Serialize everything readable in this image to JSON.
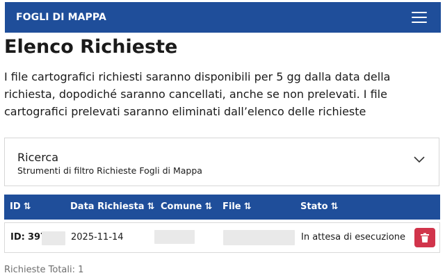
{
  "header": {
    "brand": "FOGLI DI MAPPA",
    "menu_icon": "hamburger-icon",
    "bg_color": "#1f4e9a"
  },
  "page": {
    "title": "Elenco Richieste",
    "intro": "I file cartografici richiesti saranno disponibili per 5 gg dalla data della richiesta, dopodiché saranno cancellati, anche se non prelevati. I file cartografici prelevati saranno eliminati dall’elenco delle richieste"
  },
  "search": {
    "title": "Ricerca",
    "subtitle": "Strumenti di filtro Richieste Fogli di Mappa",
    "toggle_icon": "chevron-down-icon"
  },
  "table": {
    "sort_icon_glyph": "⇅",
    "columns": [
      {
        "key": "id",
        "label": "ID"
      },
      {
        "key": "data",
        "label": "Data Richiesta"
      },
      {
        "key": "comune",
        "label": "Comune"
      },
      {
        "key": "file",
        "label": "File"
      },
      {
        "key": "stato",
        "label": "Stato"
      }
    ],
    "rows": [
      {
        "id_label": "ID:",
        "id_value": "397",
        "data": "2025-11-14",
        "comune": "",
        "file": "",
        "stato": "In attesa di esecuzione",
        "delete_icon": "trash-icon",
        "delete_color": "#d1344b"
      }
    ]
  },
  "footer": {
    "totals": "Richieste Totali: 1"
  }
}
